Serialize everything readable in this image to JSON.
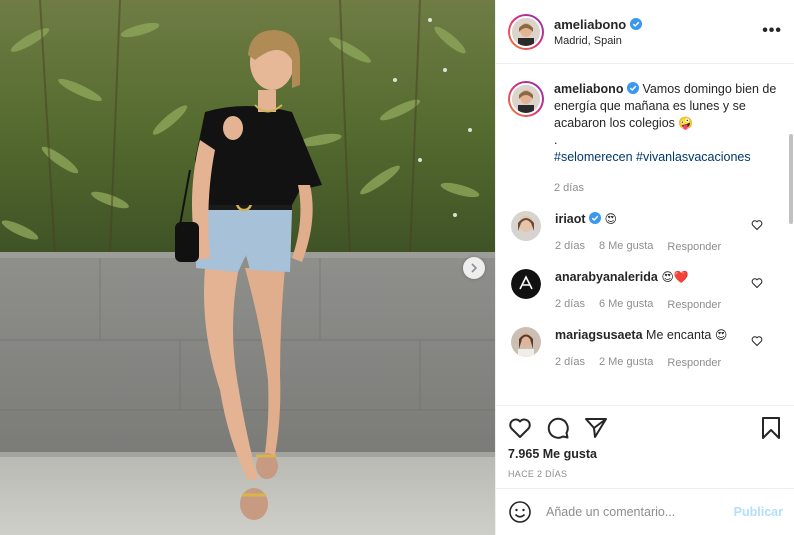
{
  "post": {
    "username": "ameliabono",
    "location": "Madrid, Spain",
    "more_label": "•••"
  },
  "caption": {
    "username": "ameliabono",
    "text": "Vamos domingo bien de energía que mañana es lunes y se acabaron los colegios",
    "emoji": "🤪",
    "dot": ".",
    "hashtags": "#selomerecen #vivanlasvacaciones",
    "time": "2 días"
  },
  "comments": [
    {
      "username": "iriaot",
      "text": "",
      "emoji": "😍",
      "time": "2 días",
      "likes": "8 Me gusta",
      "reply": "Responder"
    },
    {
      "username": "anarabyanalerida",
      "text": "",
      "emoji": "😍❤️",
      "time": "2 días",
      "likes": "6 Me gusta",
      "reply": "Responder"
    },
    {
      "username": "mariagsusaeta",
      "text": "Me encanta",
      "emoji": "😍",
      "time": "2 días",
      "likes": "2 Me gusta",
      "reply": "Responder"
    }
  ],
  "actions": {
    "likes": "7.965 Me gusta",
    "ago": "HACE 2 DÍAS"
  },
  "add_comment": {
    "placeholder": "Añade un comentario...",
    "publish": "Publicar"
  },
  "colors": {
    "link": "#00376b",
    "verified": "#3897f0",
    "publish_disabled": "#b2dffc",
    "meta": "#8e8e8e"
  },
  "icons": [
    "more-icon",
    "verified-icon",
    "heart-icon",
    "comment-icon",
    "share-icon",
    "bookmark-icon",
    "emoji-icon",
    "chevron-right-icon"
  ]
}
